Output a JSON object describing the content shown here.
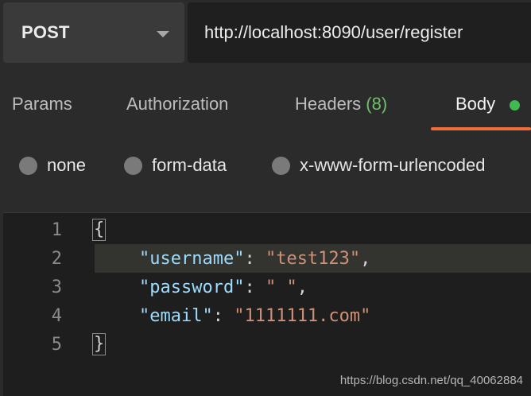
{
  "request": {
    "method": "POST",
    "url": "http://localhost:8090/user/register"
  },
  "tabs": {
    "params": "Params",
    "authorization": "Authorization",
    "headers_label": "Headers",
    "headers_count": "(8)",
    "body": "Body",
    "active": "Body",
    "accent_color": "#f06e3a",
    "indicator_color": "#3fb950"
  },
  "body_types": [
    {
      "label": "none"
    },
    {
      "label": "form-data"
    },
    {
      "label": "x-www-form-urlencoded"
    }
  ],
  "editor": {
    "lines": [
      {
        "num": "1",
        "open_brace": "{"
      },
      {
        "num": "2",
        "key": "\"username\"",
        "colon": ": ",
        "value": "\"test123\"",
        "comma": ","
      },
      {
        "num": "3",
        "key": "\"password\"",
        "colon": ": ",
        "value": "\" \"",
        "comma": ","
      },
      {
        "num": "4",
        "key": "\"email\"",
        "colon": ": ",
        "value": "\"1111111.com\""
      },
      {
        "num": "5",
        "close_brace": "}"
      }
    ]
  },
  "watermark": "https://blog.csdn.net/qq_40062884"
}
